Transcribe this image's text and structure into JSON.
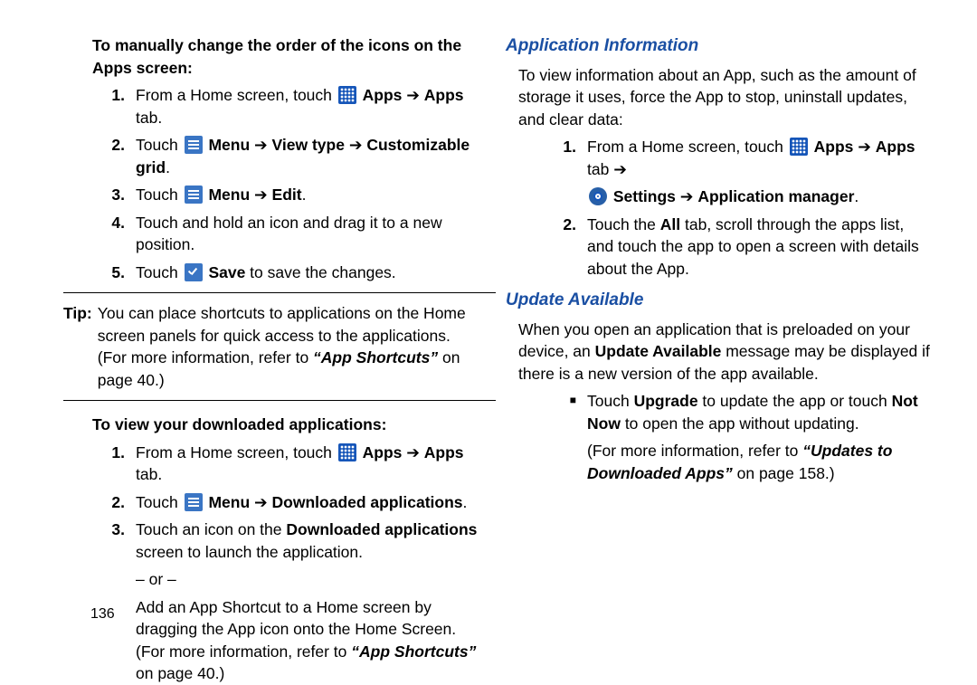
{
  "left": {
    "lead1": "To manually change the order of the icons on the Apps screen:",
    "list1": [
      {
        "n": "1.",
        "pre": "From a Home screen, touch ",
        "icon": "apps",
        "post": " <b>Apps</b> ➔ <b>Apps</b> tab."
      },
      {
        "n": "2.",
        "pre": "Touch ",
        "icon": "menu",
        "post": " <b>Menu</b> ➔ <b>View type</b> ➔ <b>Customizable grid</b>."
      },
      {
        "n": "3.",
        "pre": "Touch ",
        "icon": "menu",
        "post": " <b>Menu</b> ➔ <b>Edit</b>."
      },
      {
        "n": "4.",
        "pre": "",
        "icon": "",
        "post": "Touch and hold an icon and drag it to a new position."
      },
      {
        "n": "5.",
        "pre": "Touch ",
        "icon": "check",
        "post": " <b>Save</b> to save the changes."
      }
    ],
    "tipLabel": "Tip:",
    "tipBody": "You can place shortcuts to applications on the Home screen panels for quick access to the applications. (For more information, refer to <i><b>“App Shortcuts”</b></i> on page 40.)",
    "lead2": "To view your downloaded applications:",
    "list2": [
      {
        "n": "1.",
        "pre": "From a Home screen, touch ",
        "icon": "apps",
        "post": " <b>Apps</b> ➔ <b>Apps</b> tab."
      },
      {
        "n": "2.",
        "pre": "Touch ",
        "icon": "menu",
        "post": " <b>Menu</b> ➔ <b>Downloaded applications</b>."
      },
      {
        "n": "3.",
        "pre": "",
        "icon": "",
        "post": "Touch an icon on the <b>Downloaded applications</b> screen to launch the application.",
        "or": "– or –",
        "extra": "Add an App Shortcut to a Home screen by dragging the App icon onto the Home Screen. (For more information, refer to <i><b>“App Shortcuts”</b></i> on page 40.)"
      }
    ]
  },
  "right": {
    "h1": "Application Information",
    "p1": "To view information about an App, such as the amount of storage it uses, force the App to stop, uninstall updates, and clear data:",
    "list1": [
      {
        "n": "1.",
        "line1": {
          "pre": "From a Home screen, touch ",
          "icon": "apps",
          "post": " <b>Apps</b> ➔ <b>Apps</b> tab ➔"
        },
        "line2": {
          "icon": "settings",
          "post": " <b>Settings</b> ➔ <b>Application manager</b>."
        }
      },
      {
        "n": "2.",
        "plain": "Touch the <b>All</b> tab, scroll through the apps list, and touch the app to open a screen with details about the App."
      }
    ],
    "h2": "Update Available",
    "p2": "When you open an application that is preloaded on your device, an <b>Update Available</b> message may be displayed if there is a new version of the app available.",
    "bullet": "Touch <b>Upgrade</b> to update the app or touch <b>Not Now</b> to open the app without updating.",
    "see": "(For more information, refer to <i><b>“Updates to Downloaded Apps”</b></i> on page 158.)"
  },
  "pageNumber": "136"
}
